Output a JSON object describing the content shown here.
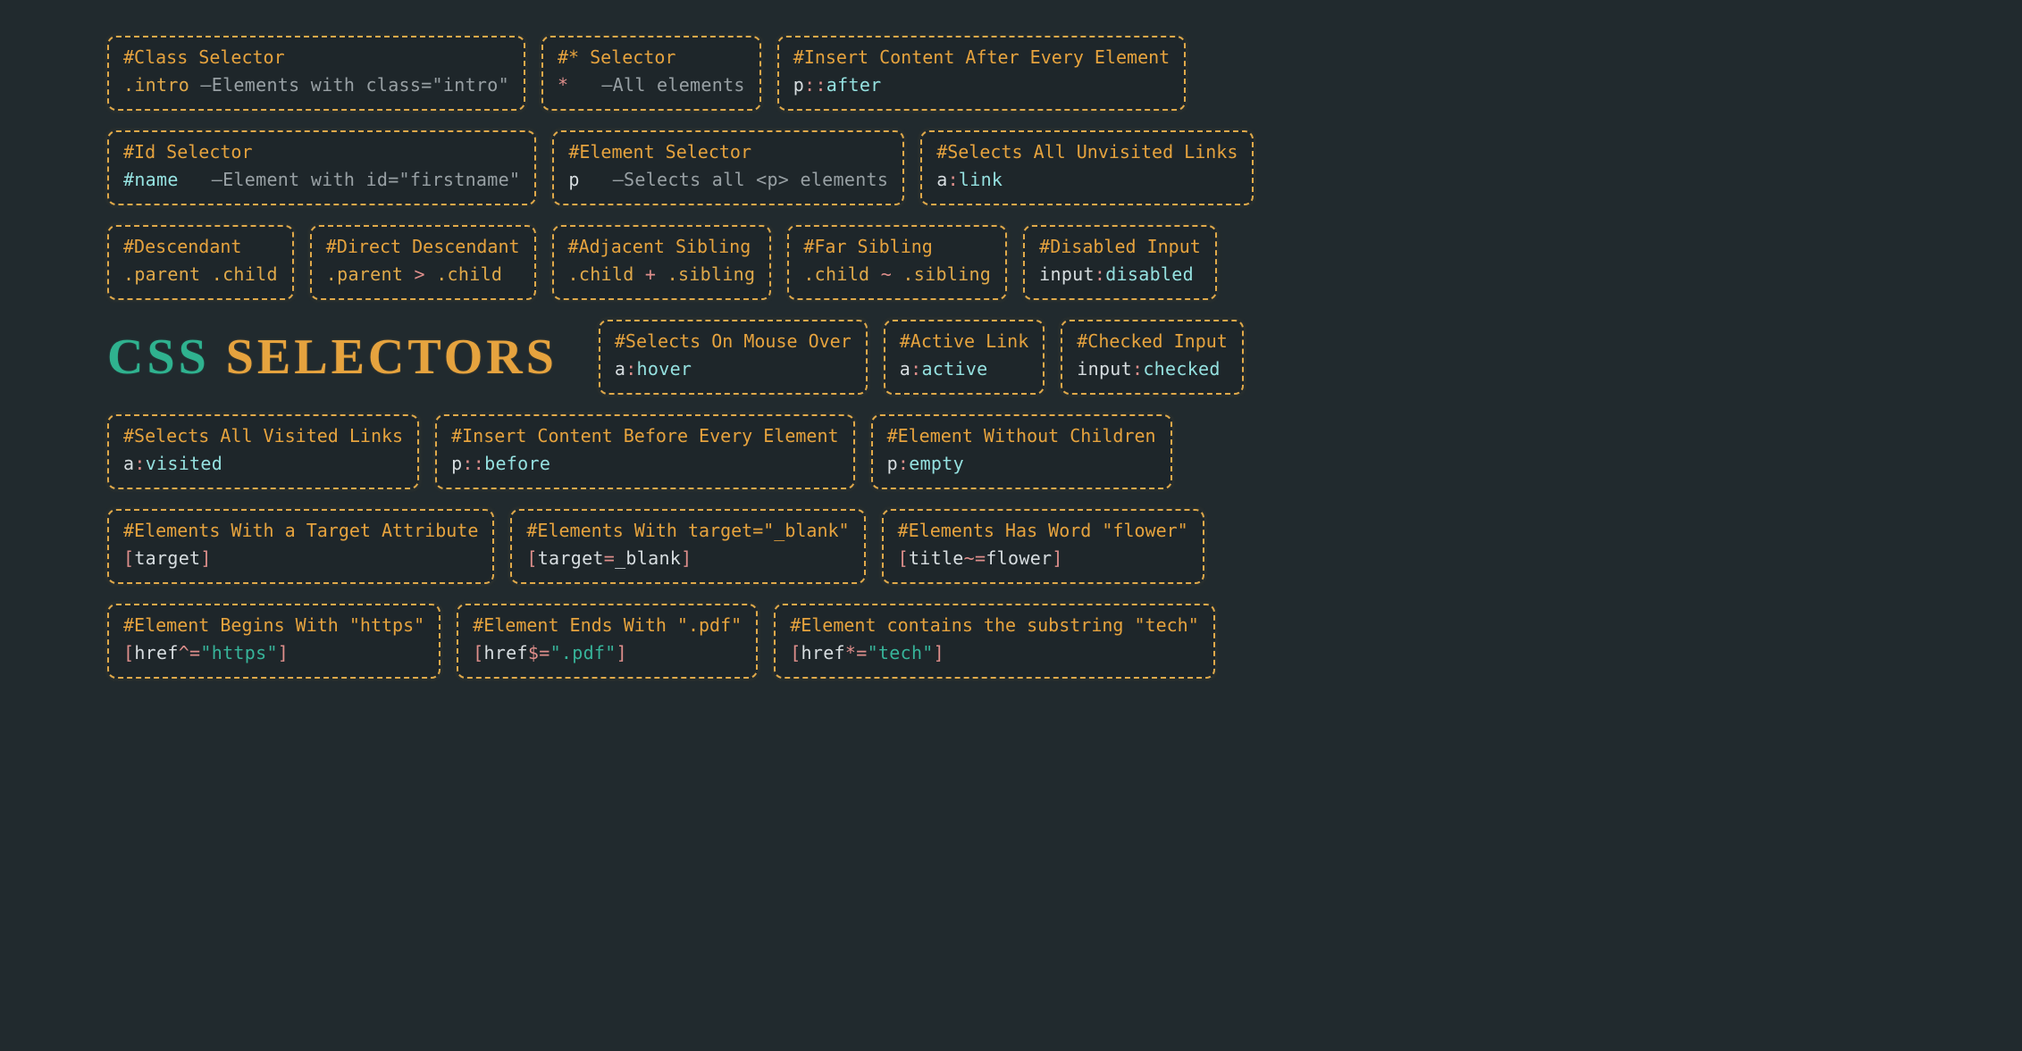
{
  "headline": {
    "css": "CSS",
    "selectors": "SELECTORS"
  },
  "row1": {
    "class_sel": {
      "t": "#Class Selector",
      "sel": ".intro",
      "sep": "–",
      "desc": "Elements with class=\"intro\""
    },
    "star_sel": {
      "t": "#* Selector",
      "sel": "*",
      "sep": "–",
      "desc": "All elements"
    },
    "after": {
      "t": "#Insert Content After Every Element",
      "el": "p",
      "op": "::",
      "ps": "after"
    }
  },
  "row2": {
    "id_sel": {
      "t": "#Id Selector",
      "sel": "#name",
      "sep": "–",
      "desc": "Element with id=\"firstname\""
    },
    "elem_sel": {
      "t": "#Element Selector",
      "el": "p",
      "sep": "–",
      "desc": "Selects all <p> elements"
    },
    "link": {
      "t": "#Selects All Unvisited Links",
      "el": "a",
      "op": ":",
      "ps": "link"
    }
  },
  "row3": {
    "descendant": {
      "t": "#Descendant",
      "a": ".parent",
      "op": " ",
      "b": ".child"
    },
    "direct": {
      "t": "#Direct Descendant",
      "a": ".parent",
      "op": " > ",
      "b": ".child"
    },
    "adjacent": {
      "t": "#Adjacent Sibling",
      "a": ".child",
      "op": " + ",
      "b": ".sibling"
    },
    "far": {
      "t": "#Far Sibling",
      "a": ".child",
      "op": " ~ ",
      "b": ".sibling"
    },
    "disabled": {
      "t": "#Disabled Input",
      "el": "input",
      "op": ":",
      "ps": "disabled"
    }
  },
  "row4": {
    "hover": {
      "t": "#Selects On Mouse Over",
      "el": "a",
      "op": ":",
      "ps": "hover"
    },
    "active": {
      "t": "#Active Link",
      "el": "a",
      "op": ":",
      "ps": "active"
    },
    "checked": {
      "t": "#Checked Input",
      "el": "input",
      "op": ":",
      "ps": "checked"
    }
  },
  "row5": {
    "visited": {
      "t": "#Selects All Visited Links",
      "el": "a",
      "op": ":",
      "ps": "visited"
    },
    "before": {
      "t": "#Insert Content Before Every Element",
      "el": "p",
      "op": "::",
      "ps": "before"
    },
    "empty": {
      "t": "#Element Without Children",
      "el": "p",
      "op": ":",
      "ps": "empty"
    }
  },
  "row6": {
    "target": {
      "t": "#Elements With a Target Attribute",
      "lb": "[",
      "attr": "target",
      "rb": "]"
    },
    "target_eq": {
      "t": "#Elements With target=\"_blank\"",
      "lb": "[",
      "attr": "target",
      "op": "=",
      "val": "_blank",
      "rb": "]"
    },
    "title_word": {
      "t": "#Elements Has Word \"flower\"",
      "lb": "[",
      "attr": "title",
      "op": "~=",
      "val": "flower",
      "rb": "]"
    }
  },
  "row7": {
    "href_start": {
      "t": "#Element Begins With \"https\"",
      "lb": "[",
      "attr": "href",
      "op": "^=",
      "val": "\"https\"",
      "rb": "]"
    },
    "href_end": {
      "t": "#Element Ends With \".pdf\"",
      "lb": "[",
      "attr": "href",
      "op": "$=",
      "val": "\".pdf\"",
      "rb": "]"
    },
    "href_has": {
      "t": "#Element contains the substring \"tech\"",
      "lb": "[",
      "attr": "href",
      "op": "*=",
      "val": "\"tech\"",
      "rb": "]"
    }
  }
}
